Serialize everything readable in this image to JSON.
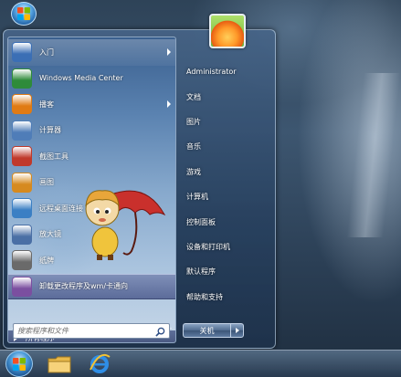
{
  "start_menu": {
    "programs": [
      {
        "label": "入门",
        "icon": "getting-started-icon",
        "has_arrow": true,
        "color": "#3b6fb5"
      },
      {
        "label": "Windows Media Center",
        "icon": "media-center-icon",
        "has_arrow": false,
        "color": "#2e8b3a"
      },
      {
        "label": "播客",
        "icon": "podcast-icon",
        "has_arrow": true,
        "color": "#e07b14"
      },
      {
        "label": "计算器",
        "icon": "calculator-icon",
        "has_arrow": false,
        "color": "#4f7db8"
      },
      {
        "label": "截图工具",
        "icon": "snipping-tool-icon",
        "has_arrow": false,
        "color": "#c0392b"
      },
      {
        "label": "画图",
        "icon": "paint-icon",
        "has_arrow": false,
        "color": "#d68a1f"
      },
      {
        "label": "远程桌面连接",
        "icon": "remote-desktop-icon",
        "has_arrow": false,
        "color": "#3b7fc4"
      },
      {
        "label": "放大镜",
        "icon": "magnifier-icon",
        "has_arrow": false,
        "color": "#4a6fa5"
      },
      {
        "label": "纸牌",
        "icon": "solitaire-icon",
        "has_arrow": false,
        "color": "#6a6a6a"
      },
      {
        "label": "卸载更改程序及wm/卡通向",
        "icon": "uninstall-icon",
        "has_arrow": false,
        "color": "#7b4fa0",
        "highlighted": true
      }
    ],
    "all_programs_label": "所有程序",
    "search": {
      "placeholder": "搜索程序和文件"
    },
    "right_items": [
      {
        "label": "Administrator",
        "name": "right-item-administrator"
      },
      {
        "label": "文档",
        "name": "right-item-documents"
      },
      {
        "label": "图片",
        "name": "right-item-pictures"
      },
      {
        "label": "音乐",
        "name": "right-item-music"
      },
      {
        "label": "游戏",
        "name": "right-item-games"
      },
      {
        "label": "计算机",
        "name": "right-item-computer"
      },
      {
        "label": "控制面板",
        "name": "right-item-control-panel"
      },
      {
        "label": "设备和打印机",
        "name": "right-item-devices-printers"
      },
      {
        "label": "默认程序",
        "name": "right-item-default-programs"
      },
      {
        "label": "帮助和支持",
        "name": "right-item-help-support"
      }
    ],
    "shutdown_label": "关机"
  },
  "taskbar": {
    "icons": [
      "start-orb-icon",
      "folder-icon",
      "internet-explorer-icon"
    ]
  },
  "colors": {
    "accent": "#3b6fb5",
    "highlight": "#5c6c9a",
    "taskbar": "#2e4560"
  }
}
